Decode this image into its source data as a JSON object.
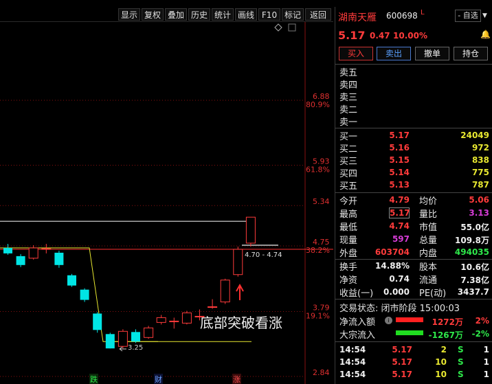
{
  "toolbar": {
    "items": [
      "显示",
      "复权",
      "叠加",
      "历史",
      "统计",
      "画线",
      "F10",
      "标记",
      "返回"
    ]
  },
  "chart": {
    "price_labels": [
      {
        "value": "6.88",
        "pct": "80.9%"
      },
      {
        "value": "5.93",
        "pct": "61.8%"
      },
      {
        "value": "5.34",
        "pct": ""
      },
      {
        "value": "4.75",
        "pct": "38.2%"
      },
      {
        "value": "3.79",
        "pct": "19.1%"
      },
      {
        "value": "2.84",
        "pct": ""
      }
    ],
    "range_label": "4.70 - 4.74",
    "low_label": "3.25",
    "annotation": "底部突破看涨",
    "markers": [
      "跌",
      "财",
      "涨"
    ]
  },
  "chart_data": {
    "type": "candlestick",
    "candles": [
      {
        "o": 4.72,
        "c": 4.64,
        "h": 4.78,
        "l": 4.62
      },
      {
        "o": 4.6,
        "c": 4.47,
        "h": 4.63,
        "l": 4.44
      },
      {
        "o": 4.57,
        "c": 4.72,
        "h": 4.76,
        "l": 4.55
      },
      {
        "o": 4.71,
        "c": 4.71,
        "h": 4.78,
        "l": 4.64
      },
      {
        "o": 4.65,
        "c": 4.47,
        "h": 4.68,
        "l": 4.43
      },
      {
        "o": 4.32,
        "c": 4.17,
        "h": 4.34,
        "l": 4.15
      },
      {
        "o": 4.11,
        "c": 3.96,
        "h": 4.13,
        "l": 3.93
      },
      {
        "o": 3.76,
        "c": 3.52,
        "h": 3.78,
        "l": 3.48
      },
      {
        "o": 3.46,
        "c": 3.25,
        "h": 3.48,
        "l": 3.25
      },
      {
        "o": 3.28,
        "c": 3.5,
        "h": 3.53,
        "l": 3.25
      },
      {
        "o": 3.49,
        "c": 3.35,
        "h": 3.53,
        "l": 3.33
      },
      {
        "o": 3.41,
        "c": 3.55,
        "h": 3.58,
        "l": 3.39
      },
      {
        "o": 3.63,
        "c": 3.7,
        "h": 3.74,
        "l": 3.6
      },
      {
        "o": 3.65,
        "c": 3.65,
        "h": 3.7,
        "l": 3.54
      },
      {
        "o": 3.62,
        "c": 3.77,
        "h": 3.8,
        "l": 3.6
      },
      {
        "o": 3.72,
        "c": 3.72,
        "h": 3.82,
        "l": 3.66
      },
      {
        "o": 3.86,
        "c": 3.86,
        "h": 3.97,
        "l": 3.83
      },
      {
        "o": 3.93,
        "c": 4.25,
        "h": 4.27,
        "l": 3.9
      },
      {
        "o": 4.33,
        "c": 4.7,
        "h": 4.74,
        "l": 4.3
      },
      {
        "o": 4.79,
        "c": 5.17,
        "h": 5.17,
        "l": 4.74
      }
    ],
    "ylim": [
      2.84,
      7.33
    ],
    "levels": [
      3.35,
      4.7,
      5.11
    ]
  },
  "stock": {
    "name": "湖南天雁",
    "code": "600698",
    "flag": "L",
    "watch_label": "- 自选",
    "price": "5.17",
    "change": "0.47",
    "pct": "10.00%"
  },
  "actions": [
    "买入",
    "卖出",
    "撤单",
    "持仓"
  ],
  "sell_orders": [
    "卖五",
    "卖四",
    "卖三",
    "卖二",
    "卖一"
  ],
  "buy_orders": [
    {
      "label": "买一",
      "price": "5.17",
      "volume": "24049"
    },
    {
      "label": "买二",
      "price": "5.16",
      "volume": "972"
    },
    {
      "label": "买三",
      "price": "5.15",
      "volume": "838"
    },
    {
      "label": "买四",
      "price": "5.14",
      "volume": "775"
    },
    {
      "label": "买五",
      "price": "5.13",
      "volume": "787"
    }
  ],
  "stats": [
    {
      "l1": "今开",
      "v1": "4.79",
      "l2": "均价",
      "v2": "5.06"
    },
    {
      "l1": "最高",
      "v1": "5.17",
      "l2": "量比",
      "v2": "3.13"
    },
    {
      "l1": "最低",
      "v1": "4.74",
      "l2": "市值",
      "v2": "55.0亿"
    },
    {
      "l1": "现量",
      "v1": "597",
      "l2": "总量",
      "v2": "109.8万"
    },
    {
      "l1": "外盘",
      "v1": "603704",
      "l2": "内盘",
      "v2": "494035"
    }
  ],
  "fundamentals": [
    {
      "l1": "换手",
      "v1": "14.88%",
      "l2": "股本",
      "v2": "10.6亿"
    },
    {
      "l1": "净资",
      "v1": "0.74",
      "l2": "流通",
      "v2": "7.38亿"
    },
    {
      "l1": "收益(一)",
      "v1": "0.000",
      "l2": "PE(动)",
      "v2": "3437.7"
    }
  ],
  "trade_status": "交易状态: 闭市阶段 15:00:03",
  "flows": [
    {
      "label": "净流入额",
      "value": "1272万",
      "pct": "2%"
    },
    {
      "label": "大宗流入",
      "value": "-1267万",
      "pct": "-2%"
    }
  ],
  "ticks": [
    {
      "time": "14:54",
      "price": "5.17",
      "vol": "2",
      "side": "S",
      "n": "1"
    },
    {
      "time": "14:54",
      "price": "5.17",
      "vol": "10",
      "side": "S",
      "n": "1"
    },
    {
      "time": "14:54",
      "price": "5.17",
      "vol": "10",
      "side": "S",
      "n": "1"
    }
  ],
  "colors": {
    "up": "#ff3b3b",
    "down": "#00e5e5",
    "grid": "#8a1010",
    "ma": "#e8e830"
  }
}
